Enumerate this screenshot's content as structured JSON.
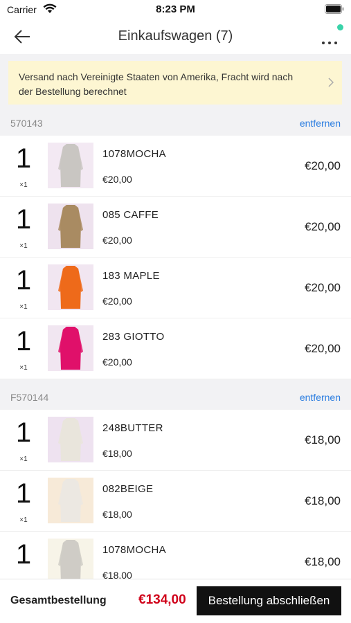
{
  "status_bar": {
    "carrier": "Carrier",
    "time": "8:23 PM"
  },
  "nav": {
    "title": "Einkaufswagen (7)"
  },
  "shipping_notice": "Versand nach Vereinigte Staaten von Amerika, Fracht wird nach der Bestellung berechnet",
  "sections": [
    {
      "id": "570143",
      "remove_label": "entfernen",
      "items": [
        {
          "qty": "1",
          "multiplier": "×1",
          "name": "1078MOCHA",
          "unit_price": "€20,00",
          "total": "€20,00",
          "color": "#c9c6c2",
          "bg": "#f3e9f3"
        },
        {
          "qty": "1",
          "multiplier": "×1",
          "name": "085 CAFFE",
          "unit_price": "€20,00",
          "total": "€20,00",
          "color": "#a98b62",
          "bg": "#eee2ee"
        },
        {
          "qty": "1",
          "multiplier": "×1",
          "name": "183 MAPLE",
          "unit_price": "€20,00",
          "total": "€20,00",
          "color": "#ee6a1a",
          "bg": "#f1e6f1"
        },
        {
          "qty": "1",
          "multiplier": "×1",
          "name": "283 GIOTTO",
          "unit_price": "€20,00",
          "total": "€20,00",
          "color": "#e0106a",
          "bg": "#f1e6f1"
        }
      ]
    },
    {
      "id": "F570144",
      "remove_label": "entfernen",
      "items": [
        {
          "qty": "1",
          "multiplier": "×1",
          "name": "248BUTTER",
          "unit_price": "€18,00",
          "total": "€18,00",
          "color": "#e9e5dc",
          "bg": "#eee2f0"
        },
        {
          "qty": "1",
          "multiplier": "×1",
          "name": "082BEIGE",
          "unit_price": "€18,00",
          "total": "€18,00",
          "color": "#ece8e2",
          "bg": "#f7ead8"
        },
        {
          "qty": "1",
          "multiplier": "",
          "name": "1078MOCHA",
          "unit_price": "€18,00",
          "total": "€18,00",
          "color": "#cfccc6",
          "bg": "#f7f4e8"
        }
      ]
    }
  ],
  "footer": {
    "total_label": "Gesamtbestellung",
    "total_amount": "€134,00",
    "checkout_label": "Bestellung abschließen"
  },
  "colors": {
    "accent_link": "#2b7de0",
    "total_red": "#d0021b",
    "banner_bg": "#fdf6d2",
    "notification_dot": "#3ad3a9"
  }
}
